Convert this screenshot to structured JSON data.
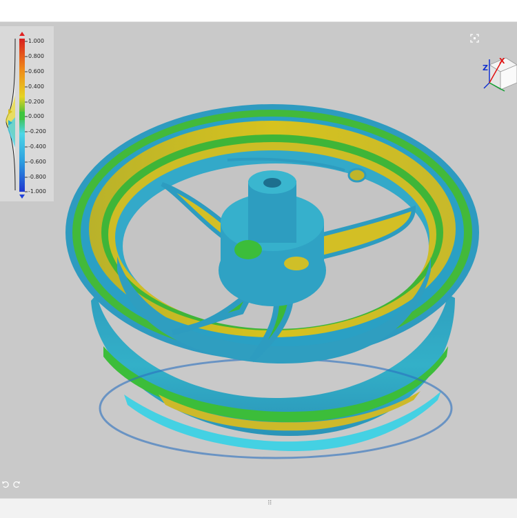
{
  "legend": {
    "ticks": [
      "1.000",
      "0.800",
      "0.600",
      "0.400",
      "0.200",
      "0.000",
      "-0.200",
      "-0.400",
      "-0.600",
      "-0.800",
      "-1.000"
    ],
    "max_arrow_color": "#e02020",
    "min_arrow_color": "#2040d8"
  },
  "cube": {
    "axis_x": "X",
    "axis_z": "Z",
    "axis_x_color": "#e01010",
    "axis_z_color": "#1030d0"
  },
  "icons": {
    "fit_view": "fit-view-icon",
    "undo": "undo-icon",
    "redo": "redo-icon",
    "grip": "⠿"
  },
  "colors": {
    "viewport_bg": "#c9c9c9",
    "deviation_positive": "#d8c21a",
    "deviation_zero": "#36b83a",
    "deviation_negative": "#2aa8c8"
  }
}
